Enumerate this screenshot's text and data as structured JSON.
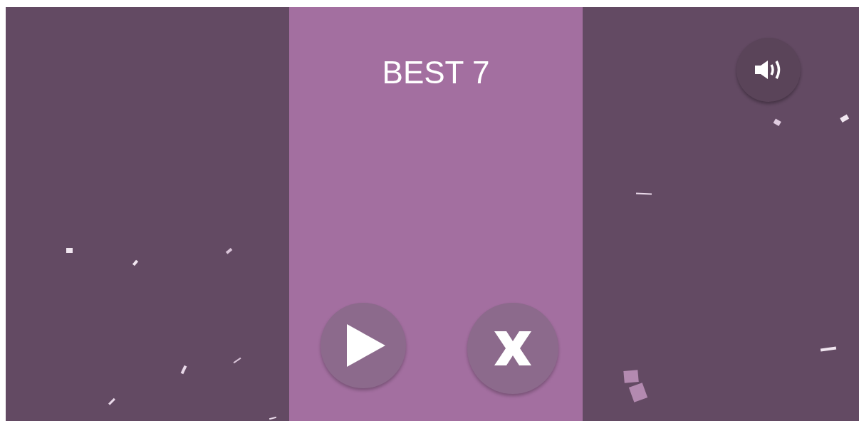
{
  "score": {
    "best": "BEST 7"
  }
}
